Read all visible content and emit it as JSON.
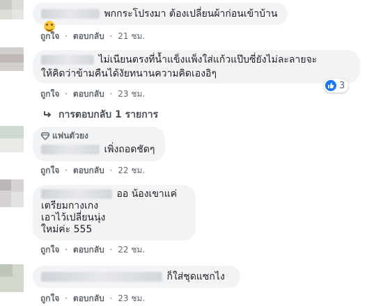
{
  "actions": {
    "like": "ถูกใจ",
    "reply": "ตอบกลับ",
    "separator": "·"
  },
  "comments": [
    {
      "text": "พกกระโปรงมา ต้องเปลี่ยนผ้าก่อนเข้าบ้าน",
      "emoji": "grinning-face",
      "time": "21 ชม."
    },
    {
      "line1": "ไม่เนียนตรงที่น้ำแข็งแพ็งใส่แก้วแป๊บซี่ยังไม่ละลายจะ",
      "line2": "ให้คิดว่าข้ามคืนได้งัยทนานความคิดเองอิๆ",
      "reaction": {
        "type": "like",
        "count": "3"
      },
      "time": "23 ชม.",
      "replies_label": "การตอบกลับ 1 รายการ"
    },
    {
      "badge": "แฟนตัวยง",
      "text": "เพิ่งถอดชัดๆ",
      "time": "22 ชม."
    },
    {
      "line1": "ออ น้องเขาแค่",
      "line2": "เตรียมกางเกง",
      "line3": "เอาไว้เปลี่ยนนุ่ง",
      "line4": "ใหม่ค่ะ 555",
      "time": "22 ชม."
    },
    {
      "text": "ก็ใส่ชุดแซกไง",
      "time": "23 ชม."
    }
  ],
  "colors": {
    "bubble": "#f2f3f5",
    "meta": "#606770",
    "like_blue": "#1877f2"
  }
}
